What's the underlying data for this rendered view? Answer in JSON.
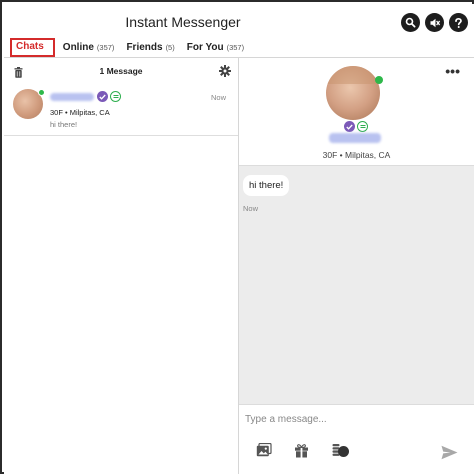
{
  "app": {
    "title": "Instant Messenger"
  },
  "header_icons": [
    "search-icon",
    "mute-icon",
    "help-icon"
  ],
  "tabs": [
    {
      "label": "Chats",
      "count": "",
      "active": true
    },
    {
      "label": "Online",
      "count": "(357)"
    },
    {
      "label": "Friends",
      "count": "(5)"
    },
    {
      "label": "For You",
      "count": "(357)"
    }
  ],
  "chat_list": {
    "header": "1 Message",
    "items": [
      {
        "meta": "30F • Milpitas, CA",
        "preview": "hi there!",
        "time": "Now",
        "online": true
      }
    ]
  },
  "profile": {
    "meta": "30F • Milpitas, CA",
    "online": true
  },
  "conversation": {
    "messages": [
      {
        "text": "hi there!",
        "time": "Now"
      }
    ]
  },
  "composer": {
    "placeholder": "Type a message...",
    "tools": [
      "photo-icon",
      "gift-icon",
      "coins-icon"
    ],
    "send_icon": "send-icon"
  },
  "colors": {
    "active_tab": "#d42b2b",
    "online": "#2eb84a",
    "verified": "#7b59b8",
    "background_conversation": "#ececec"
  }
}
